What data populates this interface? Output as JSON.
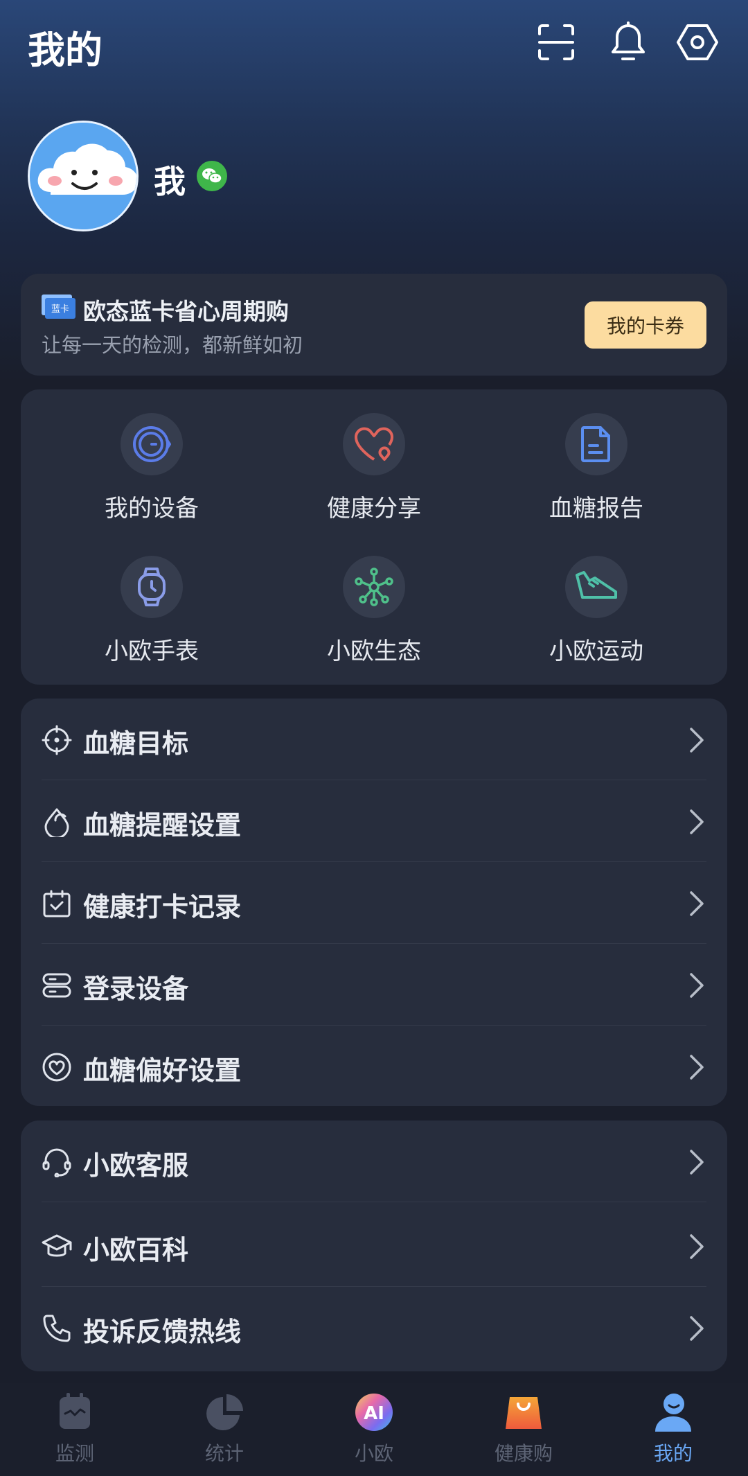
{
  "header": {
    "title": "我的"
  },
  "profile": {
    "name": "我"
  },
  "promo": {
    "badge_text": "蓝卡",
    "title": "欧态蓝卡省心周期购",
    "subtitle": "让每一天的检测，都新鲜如初",
    "button_label": "我的卡券"
  },
  "features": [
    {
      "label": "我的设备",
      "icon": "device-icon"
    },
    {
      "label": "健康分享",
      "icon": "heart-share-icon"
    },
    {
      "label": "血糖报告",
      "icon": "report-icon"
    },
    {
      "label": "小欧手表",
      "icon": "watch-icon"
    },
    {
      "label": "小欧生态",
      "icon": "ecosystem-icon"
    },
    {
      "label": "小欧运动",
      "icon": "sneaker-icon"
    }
  ],
  "settings_list": [
    {
      "label": "血糖目标",
      "icon": "target-icon"
    },
    {
      "label": "血糖提醒设置",
      "icon": "drop-reminder-icon"
    },
    {
      "label": "健康打卡记录",
      "icon": "calendar-check-icon"
    },
    {
      "label": "登录设备",
      "icon": "login-device-icon"
    },
    {
      "label": "血糖偏好设置",
      "icon": "heart-preference-icon"
    }
  ],
  "support_list": [
    {
      "label": "小欧客服",
      "icon": "headset-icon"
    },
    {
      "label": "小欧百科",
      "icon": "graduation-cap-icon"
    },
    {
      "label": "投诉反馈热线",
      "icon": "phone-icon"
    }
  ],
  "tabbar": [
    {
      "label": "监测",
      "icon": "monitor-icon"
    },
    {
      "label": "统计",
      "icon": "pie-chart-icon"
    },
    {
      "label": "小欧",
      "icon": "ai-icon",
      "icon_text": "AI"
    },
    {
      "label": "健康购",
      "icon": "shopping-bag-icon"
    },
    {
      "label": "我的",
      "icon": "user-icon",
      "active": true
    }
  ],
  "colors": {
    "accent": "#6aa8f5",
    "button_gold": "#fcdca0",
    "card_bg": "#272d3d"
  }
}
